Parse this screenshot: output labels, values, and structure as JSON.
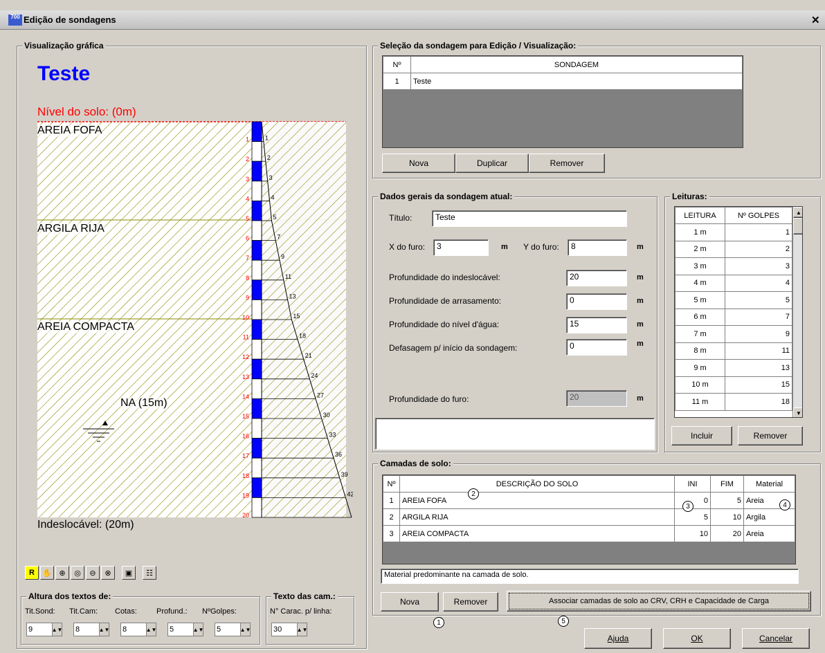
{
  "window": {
    "title": "Edição de sondagens",
    "icon": "app-icon"
  },
  "graphic": {
    "group_label": "Visualização gráfica",
    "title": "Teste",
    "ground_level": "Nível do solo: (0m)",
    "layers": [
      "AREIA FOFA",
      "ARGILA RIJA",
      "AREIA COMPACTA"
    ],
    "na_label": "NA (15m)",
    "bottom_label": "Indeslocável: (20m)",
    "depth_marks": [
      "1",
      "2",
      "3",
      "4",
      "5",
      "6",
      "7",
      "8",
      "9",
      "10",
      "11",
      "12",
      "13",
      "14",
      "15",
      "16",
      "17",
      "18",
      "19",
      "20"
    ],
    "golpes": [
      "1",
      "2",
      "3",
      "4",
      "5",
      "7",
      "9",
      "11",
      "13",
      "15",
      "18",
      "21",
      "24",
      "27",
      "30",
      "33",
      "36",
      "39",
      "42",
      "45"
    ],
    "tools": [
      "R",
      "hand-icon",
      "zoom-in-icon",
      "zoom-window-icon",
      "zoom-out-icon",
      "zoom-fit-icon",
      "save-icon",
      "properties-icon"
    ]
  },
  "alturas": {
    "group_label": "Altura dos textos de:",
    "labels": [
      "Tit.Sond:",
      "Tit.Cam:",
      "Cotas:",
      "Profund.:",
      "NºGolpes:"
    ],
    "values": [
      "9",
      "8",
      "8",
      "5",
      "5"
    ]
  },
  "texto_cam": {
    "group_label": "Texto das cam.:",
    "label": "N° Carac. p/ linha:",
    "value": "30"
  },
  "selecao": {
    "group_label": "Seleção da sondagem para Edição / Visualização:",
    "headers": [
      "Nº",
      "SONDAGEM"
    ],
    "rows": [
      [
        "1",
        "Teste"
      ]
    ],
    "buttons": [
      "Nova",
      "Duplicar",
      "Remover"
    ]
  },
  "dados": {
    "group_label": "Dados gerais da sondagem atual:",
    "titulo_label": "Título:",
    "titulo": "Teste",
    "x_label": "X do furo:",
    "x": "3",
    "y_label": "Y do furo:",
    "y": "8",
    "unit": "m",
    "indesl_label": "Profundidade do indeslocável:",
    "indesl": "20",
    "arras_label": "Profundidade de arrasamento:",
    "arras": "0",
    "nivel_label": "Profundidade do nível d'água:",
    "nivel": "15",
    "defas_label": "Defasagem p/ início da sondagem:",
    "defas": "0",
    "furo_label": "Profundidade do furo:",
    "furo": "20"
  },
  "leituras": {
    "group_label": "Leituras:",
    "headers": [
      "LEITURA",
      "Nº GOLPES"
    ],
    "rows": [
      [
        "1 m",
        "1"
      ],
      [
        "2 m",
        "2"
      ],
      [
        "3 m",
        "3"
      ],
      [
        "4 m",
        "4"
      ],
      [
        "5 m",
        "5"
      ],
      [
        "6 m",
        "7"
      ],
      [
        "7 m",
        "9"
      ],
      [
        "8 m",
        "11"
      ],
      [
        "9 m",
        "13"
      ],
      [
        "10 m",
        "15"
      ],
      [
        "11 m",
        "18"
      ]
    ],
    "buttons": [
      "Incluir",
      "Remover"
    ]
  },
  "camadas": {
    "group_label": "Camadas de solo:",
    "headers": [
      "Nº",
      "DESCRIÇÃO DO SOLO",
      "INI",
      "FIM",
      "Material"
    ],
    "rows": [
      [
        "1",
        "AREIA FOFA",
        "0",
        "5",
        "Areia"
      ],
      [
        "2",
        "ARGILA RIJA",
        "5",
        "10",
        "Argila"
      ],
      [
        "3",
        "AREIA COMPACTA",
        "10",
        "20",
        "Areia"
      ]
    ],
    "hint": "Material predominante na camada de solo.",
    "buttons": [
      "Nova",
      "Remover",
      "Associar camadas de solo ao CRV, CRH e Capacidade de Carga"
    ]
  },
  "callouts": [
    "1",
    "2",
    "3",
    "4",
    "5"
  ],
  "footer": {
    "buttons": [
      "Ajuda",
      "OK",
      "Cancelar"
    ]
  }
}
